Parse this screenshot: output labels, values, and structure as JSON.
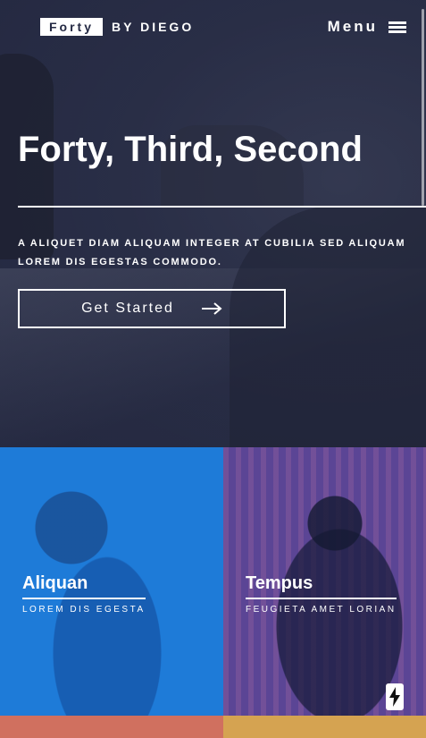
{
  "header": {
    "logo_box": "Forty",
    "logo_by": "BY DIEGO",
    "menu_label": "Menu"
  },
  "banner": {
    "title": "Forty, Third, Second",
    "text": "A ALIQUET DIAM ALIQUAM INTEGER AT CUBILIA SED ALIQUAM LOREM DIS EGESTAS COMMODO.",
    "button_label": "Get Started"
  },
  "tiles": [
    {
      "title": "Aliquan",
      "subtitle": "LOREM DIS EGESTA",
      "color": "#1e7bd8"
    },
    {
      "title": "Tempus",
      "subtitle": "FEUGIETA AMET LORIAN",
      "color": "#5e4a9a"
    },
    {
      "title": "",
      "subtitle": "",
      "color": "#d0705f"
    },
    {
      "title": "",
      "subtitle": "",
      "color": "#d5a351"
    }
  ],
  "icons": {
    "menu": "hamburger-icon",
    "arrow": "arrow-right-icon",
    "badge": "lightning-bolt-icon"
  }
}
